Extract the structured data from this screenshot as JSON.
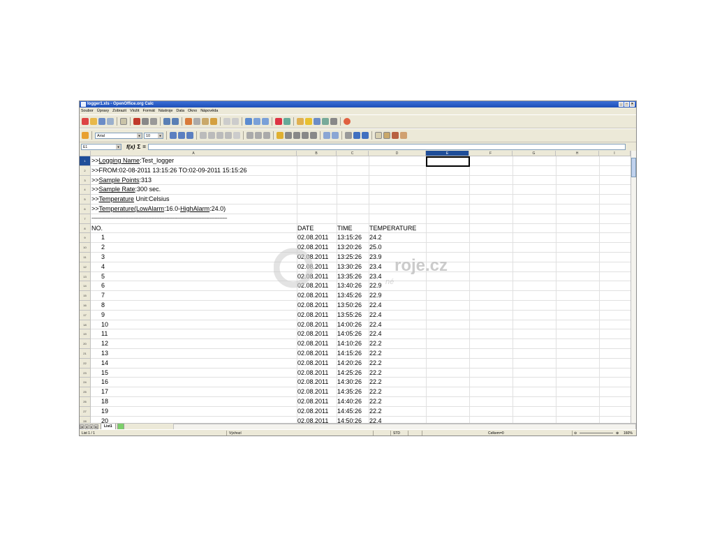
{
  "window": {
    "title": "logger1.xls - OpenOffice.org Calc"
  },
  "menu": [
    "Soubor",
    "Úpravy",
    "Zobrazit",
    "Vložit",
    "Formát",
    "Nástroje",
    "Data",
    "Okno",
    "Nápověda"
  ],
  "toolbar2": {
    "font_name": "Arial",
    "font_size": "10"
  },
  "formula": {
    "name_box": "E1",
    "input": ""
  },
  "columns": [
    "A",
    "B",
    "C",
    "D",
    "E",
    "F",
    "G",
    "H",
    "I"
  ],
  "rows_visible": [
    "1",
    "2",
    "3",
    "4",
    "5",
    "6",
    "7",
    "8",
    "9",
    "10",
    "11",
    "12",
    "13",
    "14",
    "15",
    "16",
    "17",
    "18",
    "19",
    "20",
    "21",
    "22",
    "23",
    "24",
    "25",
    "26",
    "27",
    "28"
  ],
  "header_lines": [
    {
      "prefix": ">>",
      "underlined": "Logging Name",
      "rest": ":Test_logger"
    },
    {
      "prefix": ">>FROM:02-08-2011 13:15:26   TO:02-09-2011 15:15:26",
      "underlined": "",
      "rest": ""
    },
    {
      "prefix": ">>",
      "underlined": "Sample Points",
      "rest": ":313"
    },
    {
      "prefix": ">>",
      "underlined": "Sample Rate",
      "rest": ":300 sec."
    },
    {
      "prefix": ">>",
      "underlined": "Temperature",
      "rest": " Unit:Celsius"
    },
    {
      "prefix": ">>",
      "underlined": "Temperature(LowAlarm",
      "rest": ":16.0-",
      "underlined2": "HighAlarm",
      "rest2": ":24.0)"
    }
  ],
  "dashes": "----------------------------------------------------------------------------------------------------------------",
  "table_header": {
    "no": "NO.",
    "date": "DATE",
    "time": "TIME",
    "temp": "TEMPERATURE"
  },
  "table_rows": [
    {
      "no": "1",
      "date": "02.08.2011",
      "time": "13:15:26",
      "temp": "24.2"
    },
    {
      "no": "2",
      "date": "02.08.2011",
      "time": "13:20:26",
      "temp": "25.0"
    },
    {
      "no": "3",
      "date": "02.08.2011",
      "time": "13:25:26",
      "temp": "23.9"
    },
    {
      "no": "4",
      "date": "02.08.2011",
      "time": "13:30:26",
      "temp": "23.4"
    },
    {
      "no": "5",
      "date": "02.08.2011",
      "time": "13:35:26",
      "temp": "23.4"
    },
    {
      "no": "6",
      "date": "02.08.2011",
      "time": "13:40:26",
      "temp": "22.9"
    },
    {
      "no": "7",
      "date": "02.08.2011",
      "time": "13:45:26",
      "temp": "22.9"
    },
    {
      "no": "8",
      "date": "02.08.2011",
      "time": "13:50:26",
      "temp": "22.4"
    },
    {
      "no": "9",
      "date": "02.08.2011",
      "time": "13:55:26",
      "temp": "22.4"
    },
    {
      "no": "10",
      "date": "02.08.2011",
      "time": "14:00:26",
      "temp": "22.4"
    },
    {
      "no": "11",
      "date": "02.08.2011",
      "time": "14:05:26",
      "temp": "22.4"
    },
    {
      "no": "12",
      "date": "02.08.2011",
      "time": "14:10:26",
      "temp": "22.2"
    },
    {
      "no": "13",
      "date": "02.08.2011",
      "time": "14:15:26",
      "temp": "22.2"
    },
    {
      "no": "14",
      "date": "02.08.2011",
      "time": "14:20:26",
      "temp": "22.2"
    },
    {
      "no": "15",
      "date": "02.08.2011",
      "time": "14:25:26",
      "temp": "22.2"
    },
    {
      "no": "16",
      "date": "02.08.2011",
      "time": "14:30:26",
      "temp": "22.2"
    },
    {
      "no": "17",
      "date": "02.08.2011",
      "time": "14:35:26",
      "temp": "22.2"
    },
    {
      "no": "18",
      "date": "02.08.2011",
      "time": "14:40:26",
      "temp": "22.2"
    },
    {
      "no": "19",
      "date": "02.08.2011",
      "time": "14:45:26",
      "temp": "22.2"
    },
    {
      "no": "20",
      "date": "02.08.2011",
      "time": "14:50:26",
      "temp": "22.4"
    }
  ],
  "sheet_tab": "List1",
  "status": {
    "sheet": "List 1 / 1",
    "style": "Výchozí",
    "mode": "STD",
    "sum": "Celkem=0",
    "zoom": "160%"
  },
  "watermark": {
    "text": "roje.cz",
    "sub": "né"
  }
}
